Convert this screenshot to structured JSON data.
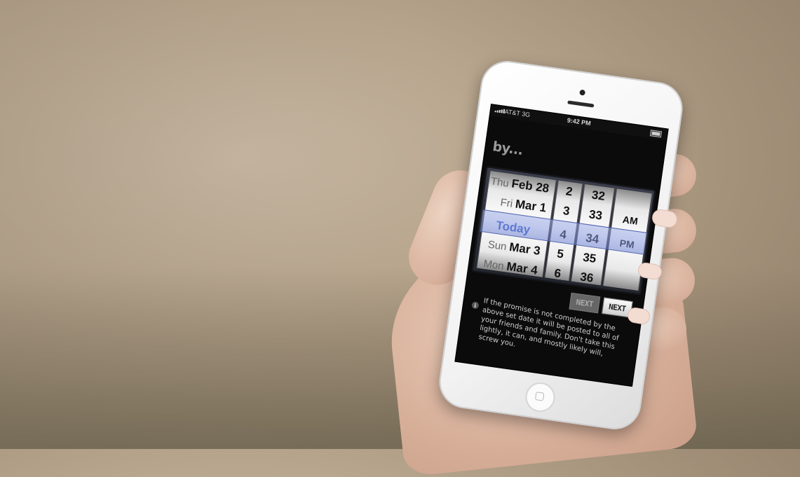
{
  "status_bar": {
    "carrier": "AT&T 3G",
    "time": "9:42 PM"
  },
  "screen_title": "by...",
  "picker": {
    "dates": [
      {
        "dow": "Thu",
        "date": "Feb 28"
      },
      {
        "dow": "Fri",
        "date": "Mar 1"
      },
      {
        "dow": "",
        "date": "Today"
      },
      {
        "dow": "Sun",
        "date": "Mar 3"
      },
      {
        "dow": "Mon",
        "date": "Mar 4"
      }
    ],
    "hours": [
      "2",
      "3",
      "4",
      "5",
      "6"
    ],
    "minutes": [
      "32",
      "33",
      "34",
      "35",
      "36"
    ],
    "ampm": [
      "AM",
      "PM"
    ]
  },
  "buttons": {
    "next_disabled": "NEXT",
    "next": "NEXT"
  },
  "info_icon": "info-icon",
  "info_text": "If the promise is not completed by the above set date it will be posted to all of your friends and family. Don't take this lightly, it can, and mostly likely will, screw you."
}
